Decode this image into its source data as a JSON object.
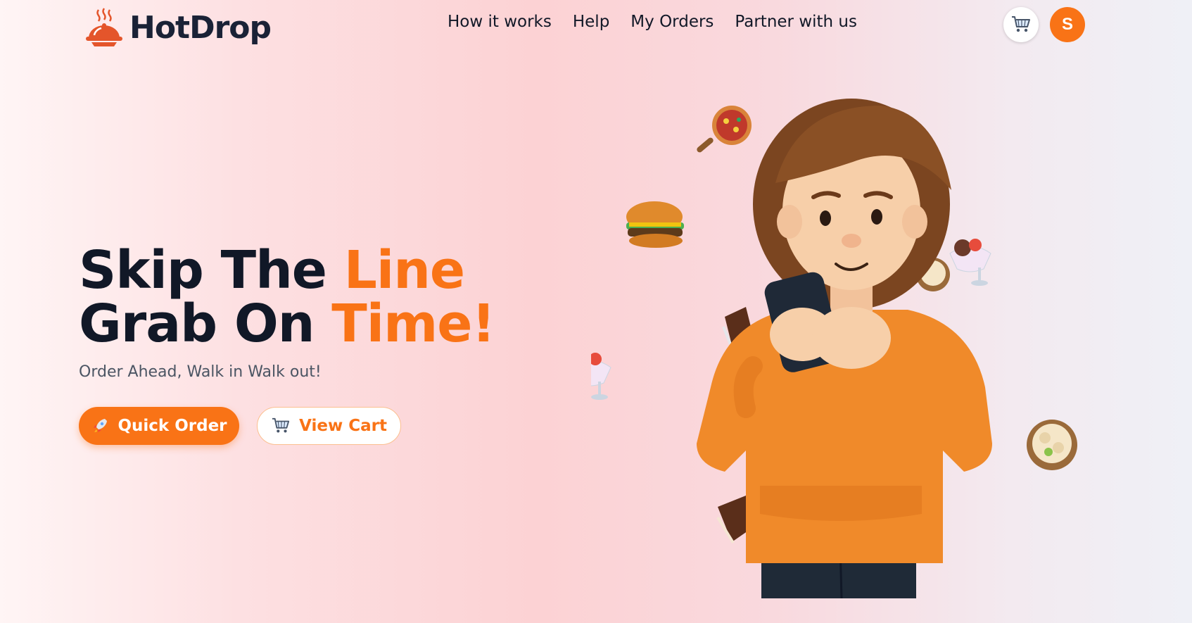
{
  "brand": {
    "name": "HotDrop"
  },
  "nav": {
    "items": [
      {
        "label": "How it works"
      },
      {
        "label": "Help"
      },
      {
        "label": "My Orders"
      },
      {
        "label": "Partner with us"
      }
    ]
  },
  "header": {
    "cart_icon": "shopping-cart-icon",
    "avatar_initial": "S"
  },
  "hero": {
    "line1_dark": "Skip The ",
    "line1_accent": "Line",
    "line2_dark": "Grab On ",
    "line2_accent": "Time!",
    "subtitle": "Order Ahead, Walk in Walk out!",
    "primary_button": {
      "icon": "rocket-icon",
      "label": "Quick Order"
    },
    "secondary_button": {
      "icon": "shopping-cart-icon",
      "label": "View Cart"
    }
  },
  "colors": {
    "accent": "#f97316",
    "dark_text": "#111827",
    "muted_text": "#4b5563"
  }
}
